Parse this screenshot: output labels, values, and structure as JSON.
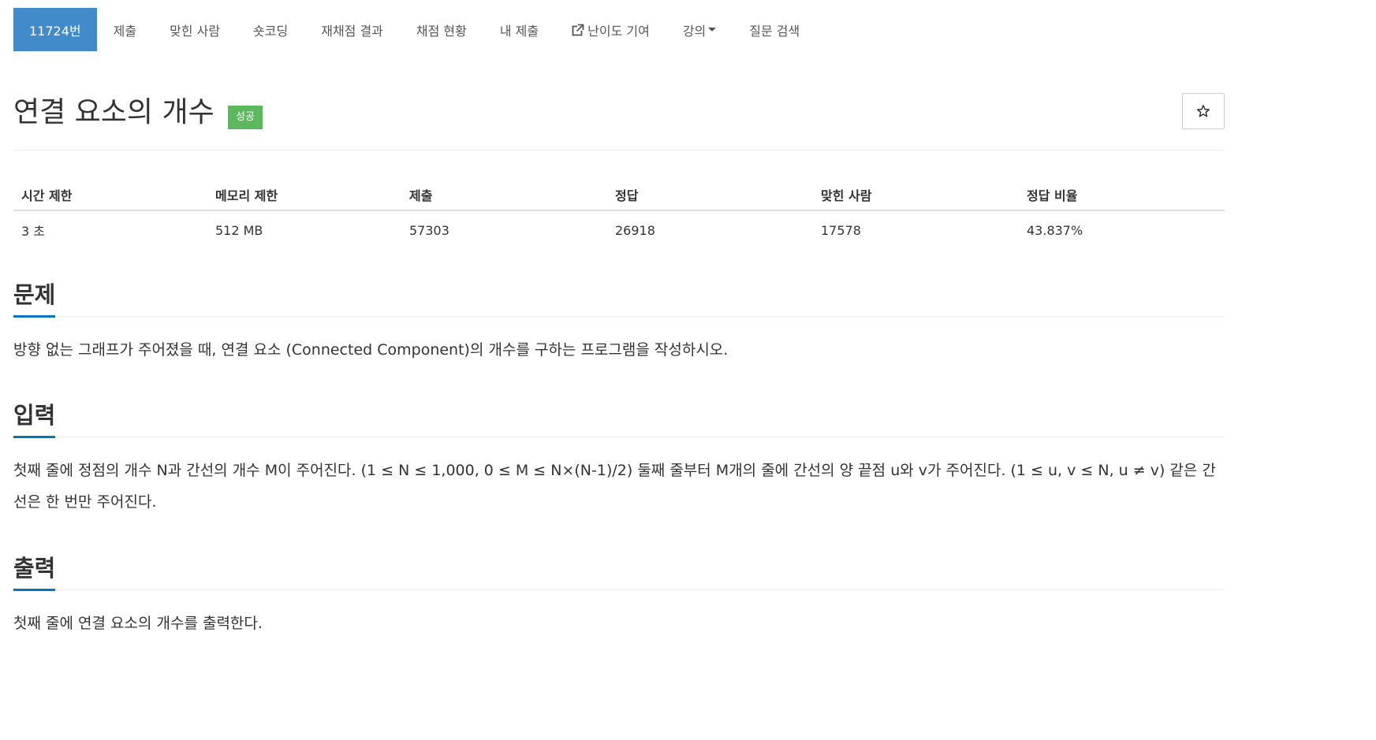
{
  "nav": {
    "items": [
      {
        "label": "11724번",
        "active": true
      },
      {
        "label": "제출"
      },
      {
        "label": "맞힌 사람"
      },
      {
        "label": "숏코딩"
      },
      {
        "label": "재채점 결과"
      },
      {
        "label": "채점 현황"
      },
      {
        "label": "내 제출"
      },
      {
        "label": "난이도 기여",
        "icon": "external-link-icon"
      },
      {
        "label": "강의",
        "icon": "caret-down-icon"
      },
      {
        "label": "질문 검색"
      }
    ]
  },
  "problem": {
    "title": "연결 요소의 개수",
    "badge": "성공",
    "star_icon": "star-outline-icon"
  },
  "stats": {
    "headers": [
      "시간 제한",
      "메모리 제한",
      "제출",
      "정답",
      "맞힌 사람",
      "정답 비율"
    ],
    "values": [
      "3 초",
      "512 MB",
      "57303",
      "26918",
      "17578",
      "43.837%"
    ]
  },
  "sections": {
    "description": {
      "title": "문제",
      "text": "방향 없는 그래프가 주어졌을 때, 연결 요소 (Connected Component)의 개수를 구하는 프로그램을 작성하시오."
    },
    "input": {
      "title": "입력",
      "text": "첫째 줄에 정점의 개수 N과 간선의 개수 M이 주어진다. (1 ≤ N ≤ 1,000, 0 ≤ M ≤ N×(N-1)/2) 둘째 줄부터 M개의 줄에 간선의 양 끝점 u와 v가 주어진다. (1 ≤ u, v ≤ N, u ≠ v) 같은 간선은 한 번만 주어진다."
    },
    "output": {
      "title": "출력",
      "text": "첫째 줄에 연결 요소의 개수를 출력한다."
    }
  },
  "colors": {
    "active_tab": "#428bca",
    "badge": "#5cb85c",
    "section_underline": "#0076c0"
  }
}
